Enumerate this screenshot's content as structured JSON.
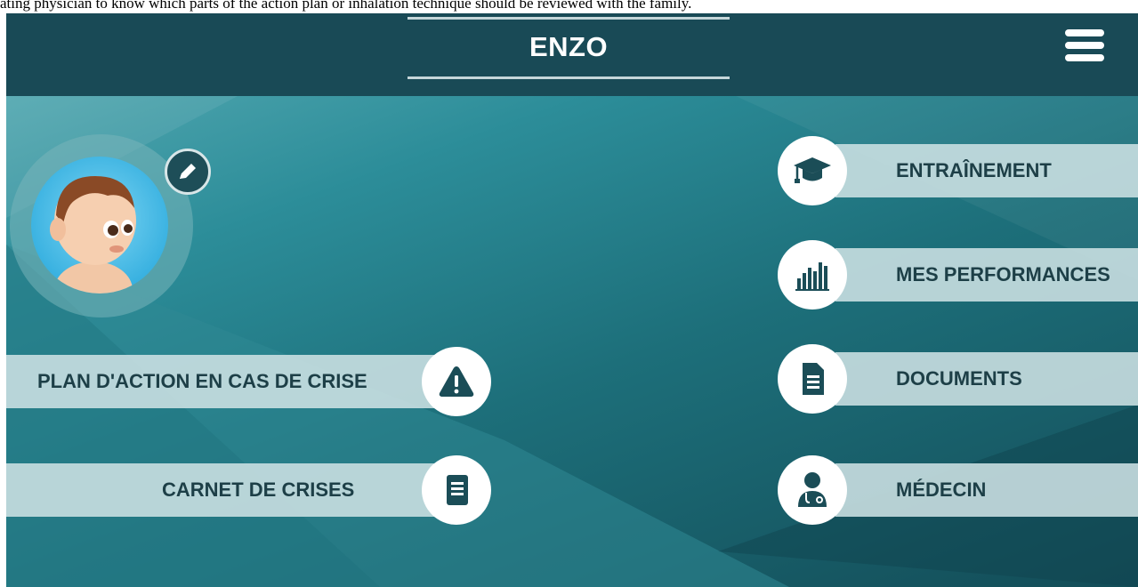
{
  "caption": "ating physician to know which parts of the action plan or inhalation technique should be reviewed with the family.",
  "header": {
    "title": "ENZO"
  },
  "right_menu": [
    {
      "label": "ENTRAÎNEMENT",
      "icon": "graduation-cap-icon"
    },
    {
      "label": "MES PERFORMANCES",
      "icon": "bar-chart-icon"
    },
    {
      "label": "DOCUMENTS",
      "icon": "document-icon"
    },
    {
      "label": "MÉDECIN",
      "icon": "doctor-icon"
    }
  ],
  "left_menu": [
    {
      "label": "PLAN D'ACTION EN CAS DE CRISE",
      "icon": "warning-icon"
    },
    {
      "label": "CARNET DE CRISES",
      "icon": "notebook-icon"
    }
  ],
  "colors": {
    "header": "#194a56",
    "band": "#cde1e4",
    "icon": "#1b4d57",
    "avatar_bg": "#3ab2e1"
  }
}
